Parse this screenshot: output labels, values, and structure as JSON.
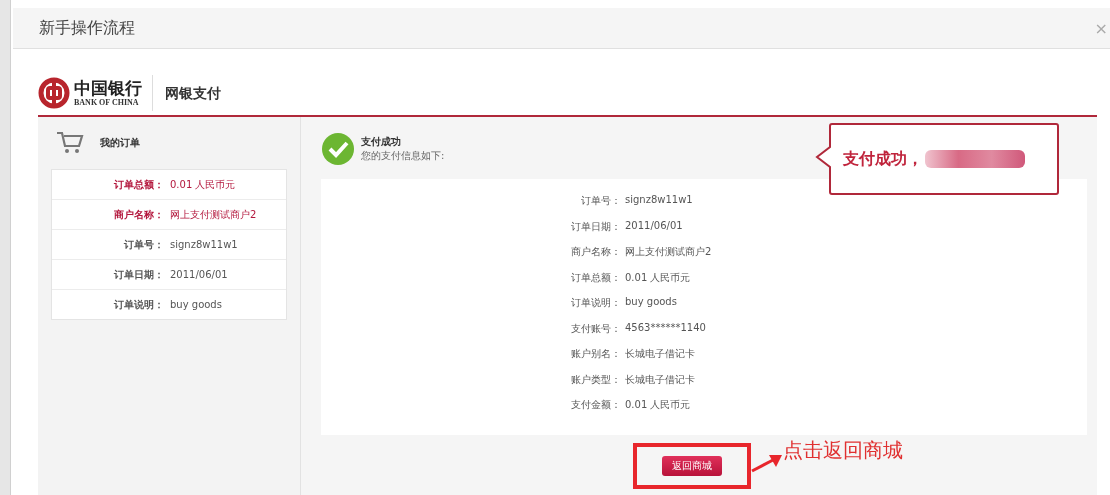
{
  "dialog": {
    "title": "新手操作流程",
    "close": "×"
  },
  "header": {
    "bank_name": "中国银行",
    "bank_name_en": "BANK OF CHINA",
    "service": "网银支付"
  },
  "order_panel": {
    "title": "我的订单",
    "rows": [
      {
        "label": "订单总额：",
        "value": "0.01 人民币元",
        "highlighted": true
      },
      {
        "label": "商户名称：",
        "value": "网上支付测试商户2",
        "highlighted": true
      },
      {
        "label": "订单号：",
        "value": "signz8w11w1",
        "highlighted": false
      },
      {
        "label": "订单日期：",
        "value": "2011/06/01",
        "highlighted": false
      },
      {
        "label": "订单说明：",
        "value": "buy goods",
        "highlighted": false
      }
    ]
  },
  "result": {
    "title": "支付成功",
    "subtitle": "您的支付信息如下:",
    "details": [
      {
        "label": "订单号：",
        "value": "signz8w11w1"
      },
      {
        "label": "订单日期：",
        "value": "2011/06/01"
      },
      {
        "label": "商户名称：",
        "value": "网上支付测试商户2"
      },
      {
        "label": "订单总额：",
        "value": "0.01 人民币元"
      },
      {
        "label": "订单说明：",
        "value": "buy goods"
      },
      {
        "label": "支付账号：",
        "value": "4563******1140"
      },
      {
        "label": "账户别名：",
        "value": "长城电子借记卡"
      },
      {
        "label": "账户类型：",
        "value": "长城电子借记卡"
      },
      {
        "label": "支付金额：",
        "value": "0.01 人民币元"
      }
    ],
    "button": "返回商城"
  },
  "callout": {
    "text": "支付成功，"
  },
  "annotation": {
    "text": "点击返回商城"
  }
}
